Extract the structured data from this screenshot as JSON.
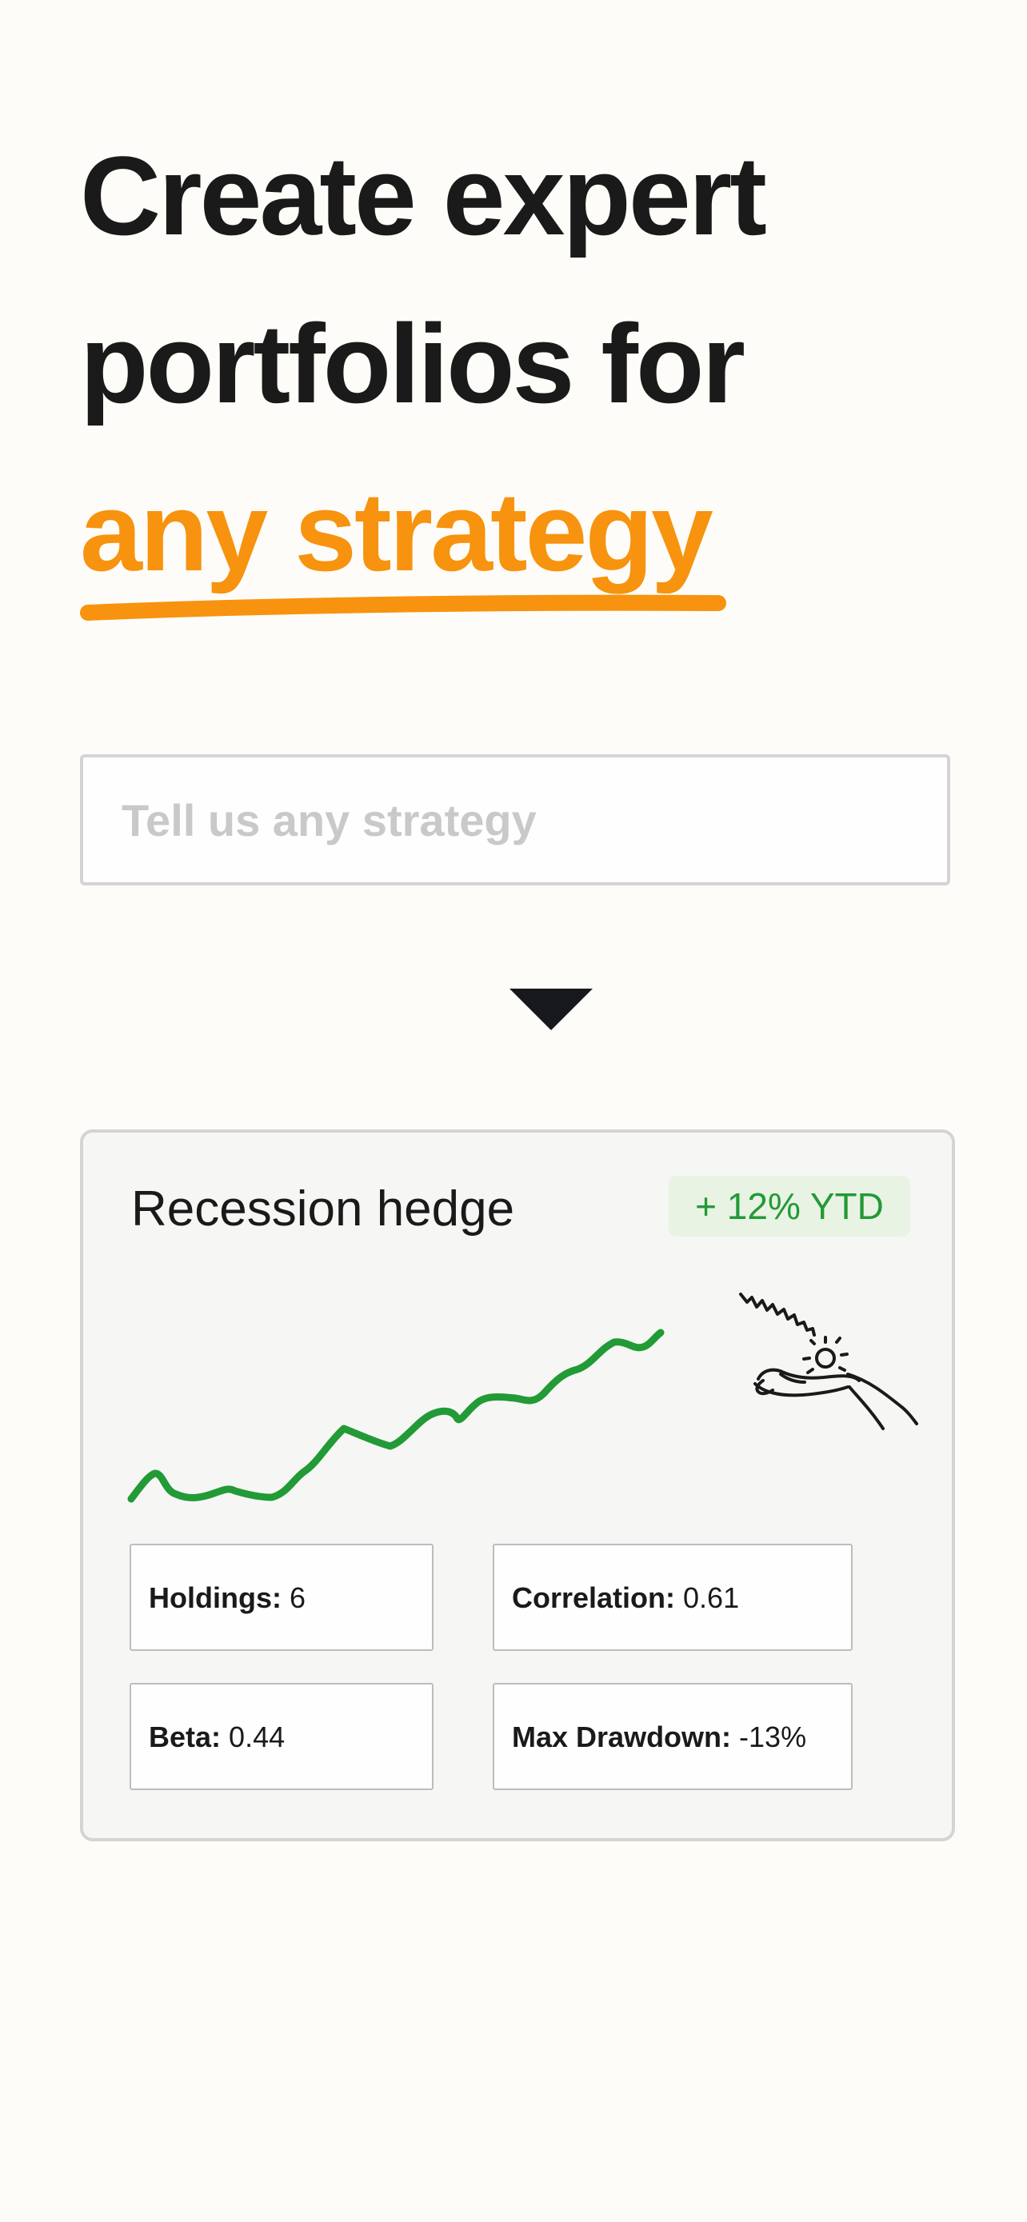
{
  "hero": {
    "line1": "Create expert",
    "line2": "portfolios for",
    "line3": "any strategy"
  },
  "strategy_input": {
    "placeholder": "Tell us any strategy",
    "value": ""
  },
  "card": {
    "title": "Recession hedge",
    "badge": "+ 12% YTD",
    "stats": [
      {
        "label": "Holdings:",
        "value": "6"
      },
      {
        "label": "Correlation:",
        "value": "0.61"
      },
      {
        "label": "Beta:",
        "value": "0.44"
      },
      {
        "label": "Max Drawdown:",
        "value": "-13%"
      }
    ]
  },
  "colors": {
    "background": "#fdfcf8",
    "accent": "#f7930e",
    "positive": "#229a36",
    "text": "#1a1a1a"
  },
  "icons": {
    "arrow": "arrow-down-icon",
    "illustration": "hand-catching-coin-icon"
  }
}
